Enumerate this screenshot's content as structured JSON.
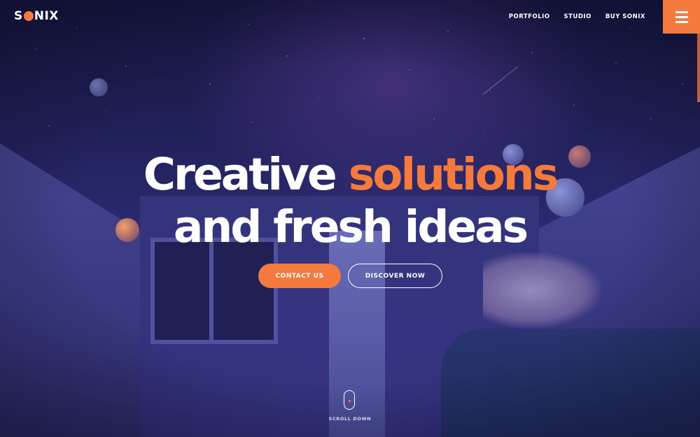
{
  "brand": {
    "logo_prefix": "S",
    "logo_suffix": "NIX",
    "accent_color": "#f47a3d"
  },
  "nav": {
    "items": [
      {
        "label": "PORTFOLIO"
      },
      {
        "label": "STUDIO"
      },
      {
        "label": "BUY SONIX"
      }
    ],
    "menu_icon": "hamburger-icon"
  },
  "hero": {
    "headline_part1": "Creative",
    "headline_accent": "solutions",
    "headline_line2": "and fresh ideas",
    "contact_label": "CONTACT US",
    "discover_label": "DISCOVER NOW",
    "scroll_label": "SCROLL DOWN",
    "scroll_icon": "mouse-icon"
  }
}
